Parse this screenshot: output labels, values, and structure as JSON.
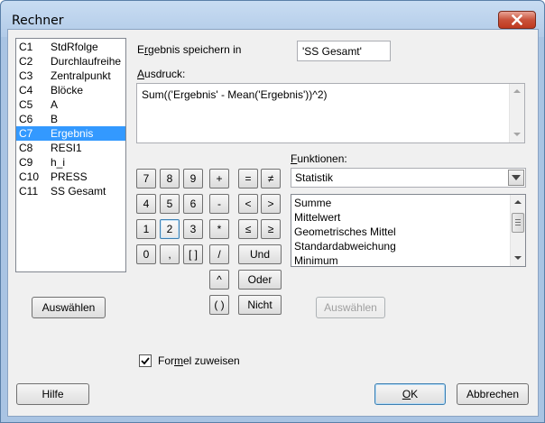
{
  "window": {
    "title": "Rechner"
  },
  "columns": [
    {
      "id": "C1",
      "name": "StdRfolge"
    },
    {
      "id": "C2",
      "name": "Durchlaufreihe"
    },
    {
      "id": "C3",
      "name": "Zentralpunkt"
    },
    {
      "id": "C4",
      "name": "Blöcke"
    },
    {
      "id": "C5",
      "name": "A"
    },
    {
      "id": "C6",
      "name": "B"
    },
    {
      "id": "C7",
      "name": "Ergebnis",
      "selected": true
    },
    {
      "id": "C8",
      "name": "RESI1"
    },
    {
      "id": "C9",
      "name": "h_i"
    },
    {
      "id": "C10",
      "name": "PRESS"
    },
    {
      "id": "C11",
      "name": "SS Gesamt"
    }
  ],
  "store": {
    "label_pre": "E",
    "label_u": "r",
    "label_post": "gebnis speichern in",
    "value": "'SS Gesamt'"
  },
  "expression": {
    "label_u": "A",
    "label_post": "usdruck:",
    "value": "Sum(('Ergebnis' - Mean('Ergebnis'))^2)"
  },
  "keypad": {
    "row1": [
      "7",
      "8",
      "9",
      "+",
      "=",
      "≠"
    ],
    "row2": [
      "4",
      "5",
      "6",
      "-",
      "<",
      ">"
    ],
    "row3": [
      "1",
      "2",
      "3",
      "*",
      "≤",
      "≥"
    ],
    "row4": [
      "0",
      ",",
      "[ ]",
      "/"
    ],
    "and": "Und",
    "power": "^",
    "or": "Oder",
    "parens": "( )",
    "not": "Nicht"
  },
  "functions": {
    "label_u": "F",
    "label_post": "unktionen:",
    "category": "Statistik",
    "items": [
      "Summe",
      "Mittelwert",
      "Geometrisches Mittel",
      "Standardabweichung",
      "Minimum"
    ]
  },
  "buttons": {
    "select_columns": "Auswählen",
    "select_function": "Auswählen",
    "help": "Hilfe",
    "ok_u": "O",
    "ok_post": "K",
    "cancel": "Abbrechen"
  },
  "assign_formula": {
    "checked": true,
    "label_pre": "For",
    "label_u": "m",
    "label_post": "el zuweisen"
  },
  "colors": {
    "selection": "#3399ff",
    "close_button": "#c0391f",
    "title_bar": "#b2cbe8"
  }
}
